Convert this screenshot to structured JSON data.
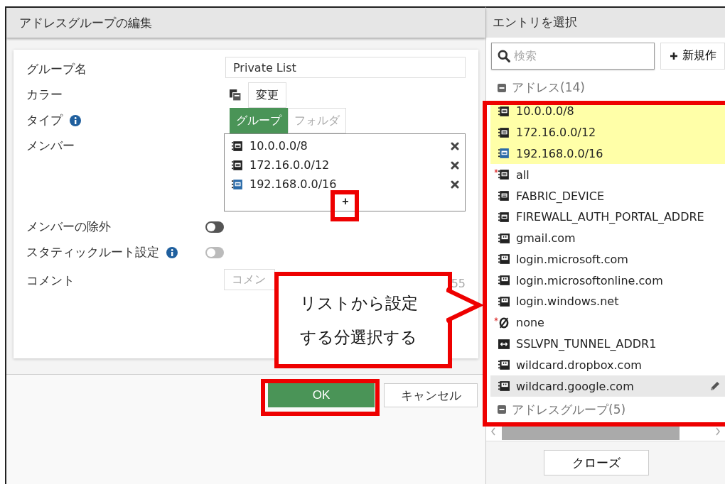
{
  "editor": {
    "title": "アドレスグループの編集",
    "fields": [
      {
        "kind": "text",
        "label": "グループ名",
        "value": "Private List"
      },
      {
        "kind": "color",
        "label": "カラー",
        "button": "変更"
      },
      {
        "kind": "segmented",
        "label": "タイプ",
        "info": true,
        "options": [
          {
            "label": "グループ",
            "selected": true
          },
          {
            "label": "フォルダ",
            "selected": false
          }
        ]
      },
      {
        "kind": "members",
        "label": "メンバー",
        "members": [
          {
            "name": "10.0.0.0/8",
            "kind": "subnet"
          },
          {
            "name": "172.16.0.0/12",
            "kind": "subnet"
          },
          {
            "name": "192.168.0.0/16",
            "kind": "interface-subnet"
          }
        ],
        "add": "+"
      },
      {
        "kind": "toggle",
        "label": "メンバーの除外",
        "info": false,
        "on": false,
        "disabled": false
      },
      {
        "kind": "toggle",
        "label": "スタティックルート設定",
        "info": true,
        "on": false,
        "disabled": true
      },
      {
        "kind": "comment",
        "label": "コメント",
        "placeholder": "コメン",
        "counter": "55"
      }
    ],
    "buttons": [
      {
        "label": "OK",
        "primary": true
      },
      {
        "label": "キャンセル",
        "primary": false
      }
    ]
  },
  "picker": {
    "title": "エントリを選択",
    "search": {
      "placeholder": "検索"
    },
    "new_button": "新規作",
    "groups": [
      {
        "label": "アドレス(14)",
        "expanded": true,
        "items": [
          {
            "name": "10.0.0.0/8",
            "kind": "subnet",
            "selected": true,
            "marked": false,
            "hovered": false
          },
          {
            "name": "172.16.0.0/12",
            "kind": "subnet",
            "selected": true,
            "marked": false,
            "hovered": false
          },
          {
            "name": "192.168.0.0/16",
            "kind": "interface-subnet",
            "selected": true,
            "marked": false,
            "hovered": false
          },
          {
            "name": "all",
            "kind": "subnet",
            "selected": false,
            "marked": true,
            "hovered": false
          },
          {
            "name": "FABRIC_DEVICE",
            "kind": "subnet",
            "selected": false,
            "marked": false,
            "hovered": false
          },
          {
            "name": "FIREWALL_AUTH_PORTAL_ADDRE",
            "kind": "subnet",
            "selected": false,
            "marked": false,
            "hovered": false
          },
          {
            "name": "gmail.com",
            "kind": "fqdn",
            "selected": false,
            "marked": false,
            "hovered": false
          },
          {
            "name": "login.microsoft.com",
            "kind": "fqdn",
            "selected": false,
            "marked": false,
            "hovered": false
          },
          {
            "name": "login.microsoftonline.com",
            "kind": "fqdn",
            "selected": false,
            "marked": false,
            "hovered": false
          },
          {
            "name": "login.windows.net",
            "kind": "fqdn",
            "selected": false,
            "marked": false,
            "hovered": false
          },
          {
            "name": "none",
            "kind": "none",
            "selected": false,
            "marked": true,
            "hovered": false
          },
          {
            "name": "SSLVPN_TUNNEL_ADDR1",
            "kind": "range",
            "selected": false,
            "marked": false,
            "hovered": false
          },
          {
            "name": "wildcard.dropbox.com",
            "kind": "fqdn",
            "selected": false,
            "marked": false,
            "hovered": false
          },
          {
            "name": "wildcard.google.com",
            "kind": "fqdn",
            "selected": false,
            "marked": false,
            "hovered": true
          }
        ]
      },
      {
        "label": "アドレスグループ(5)",
        "expanded": true
      }
    ],
    "close_button": "クローズ"
  },
  "annotation": {
    "callout": "リストから設定する分選択する"
  }
}
